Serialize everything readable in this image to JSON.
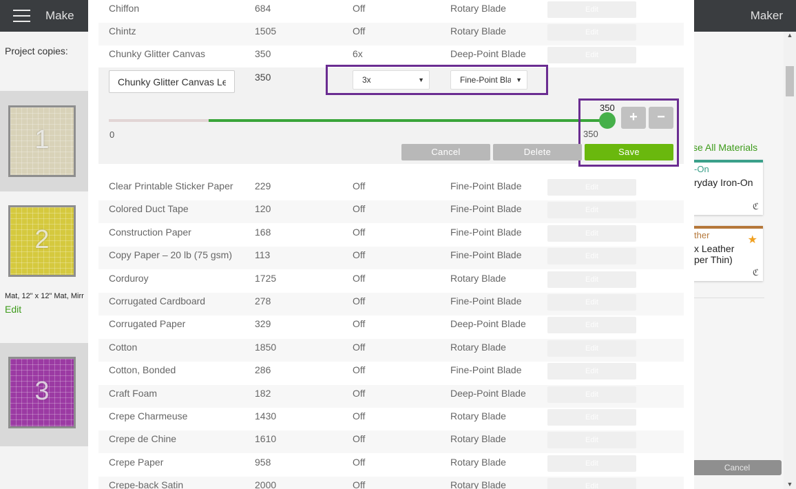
{
  "app": {
    "title": "Make",
    "machine": "Maker"
  },
  "left_panel": {
    "project_copies_label": "Project copies:",
    "mats": [
      {
        "number": "1",
        "color": "#d8d2b8"
      },
      {
        "number": "2",
        "color": "#d5c93e"
      },
      {
        "number": "3",
        "color": "#9b3aa3"
      }
    ],
    "mat_description": "Mat, 12\" x 12\" Mat, Mirr",
    "edit_label": "Edit"
  },
  "right_panel": {
    "browse_label": "se All Materials",
    "cards": [
      {
        "category": "-On",
        "name": "ryday Iron-On",
        "color": "#3aa08a"
      },
      {
        "category": "ther",
        "name": "x Leather\nper Thin)",
        "color": "#b5783a"
      }
    ],
    "cancel_label": "Cancel"
  },
  "materials_table": {
    "rows_above": [
      {
        "name": "Chiffon",
        "pressure": "684",
        "multi_cut": "Off",
        "blade": "Rotary Blade",
        "edit": "Edit"
      },
      {
        "name": "Chintz",
        "pressure": "1505",
        "multi_cut": "Off",
        "blade": "Rotary Blade",
        "edit": "Edit"
      },
      {
        "name": "Chunky Glitter Canvas",
        "pressure": "350",
        "multi_cut": "6x",
        "blade": "Deep-Point Blade",
        "edit": "Edit"
      }
    ],
    "editing": {
      "name_value": "Chunky Glitter Canvas Less",
      "pressure": "350",
      "multi_cut_value": "3x",
      "blade_value": "Fine-Point Blade",
      "slider_min": "0",
      "slider_value": "350",
      "slider_value_below": "350",
      "slider_fill_start": 0.2,
      "slider_fill_end": 1.0,
      "plus_label": "+",
      "minus_label": "−",
      "cancel_label": "Cancel",
      "delete_label": "Delete",
      "save_label": "Save"
    },
    "rows_below": [
      {
        "name": "Clear Printable Sticker Paper",
        "pressure": "229",
        "multi_cut": "Off",
        "blade": "Fine-Point Blade",
        "edit": "Edit"
      },
      {
        "name": "Colored Duct Tape",
        "pressure": "120",
        "multi_cut": "Off",
        "blade": "Fine-Point Blade",
        "edit": "Edit"
      },
      {
        "name": "Construction Paper",
        "pressure": "168",
        "multi_cut": "Off",
        "blade": "Fine-Point Blade",
        "edit": "Edit"
      },
      {
        "name": "Copy Paper – 20 lb (75 gsm)",
        "pressure": "113",
        "multi_cut": "Off",
        "blade": "Fine-Point Blade",
        "edit": "Edit"
      },
      {
        "name": "Corduroy",
        "pressure": "1725",
        "multi_cut": "Off",
        "blade": "Rotary Blade",
        "edit": "Edit"
      },
      {
        "name": "Corrugated Cardboard",
        "pressure": "278",
        "multi_cut": "Off",
        "blade": "Fine-Point Blade",
        "edit": "Edit"
      },
      {
        "name": "Corrugated Paper",
        "pressure": "329",
        "multi_cut": "Off",
        "blade": "Deep-Point Blade",
        "edit": "Edit"
      },
      {
        "name": "Cotton",
        "pressure": "1850",
        "multi_cut": "Off",
        "blade": "Rotary Blade",
        "edit": "Edit"
      },
      {
        "name": "Cotton, Bonded",
        "pressure": "286",
        "multi_cut": "Off",
        "blade": "Fine-Point Blade",
        "edit": "Edit"
      },
      {
        "name": "Craft Foam",
        "pressure": "182",
        "multi_cut": "Off",
        "blade": "Deep-Point Blade",
        "edit": "Edit"
      },
      {
        "name": "Crepe Charmeuse",
        "pressure": "1430",
        "multi_cut": "Off",
        "blade": "Rotary Blade",
        "edit": "Edit"
      },
      {
        "name": "Crepe de Chine",
        "pressure": "1610",
        "multi_cut": "Off",
        "blade": "Rotary Blade",
        "edit": "Edit"
      },
      {
        "name": "Crepe Paper",
        "pressure": "958",
        "multi_cut": "Off",
        "blade": "Rotary Blade",
        "edit": "Edit"
      },
      {
        "name": "Crepe-back Satin",
        "pressure": "2000",
        "multi_cut": "Off",
        "blade": "Rotary Blade",
        "edit": "Edit"
      }
    ]
  },
  "colors": {
    "highlight": "#6a2c91",
    "save_green": "#6ab80e",
    "slider_green": "#3aa53a",
    "link_green": "#3d9b1a"
  }
}
